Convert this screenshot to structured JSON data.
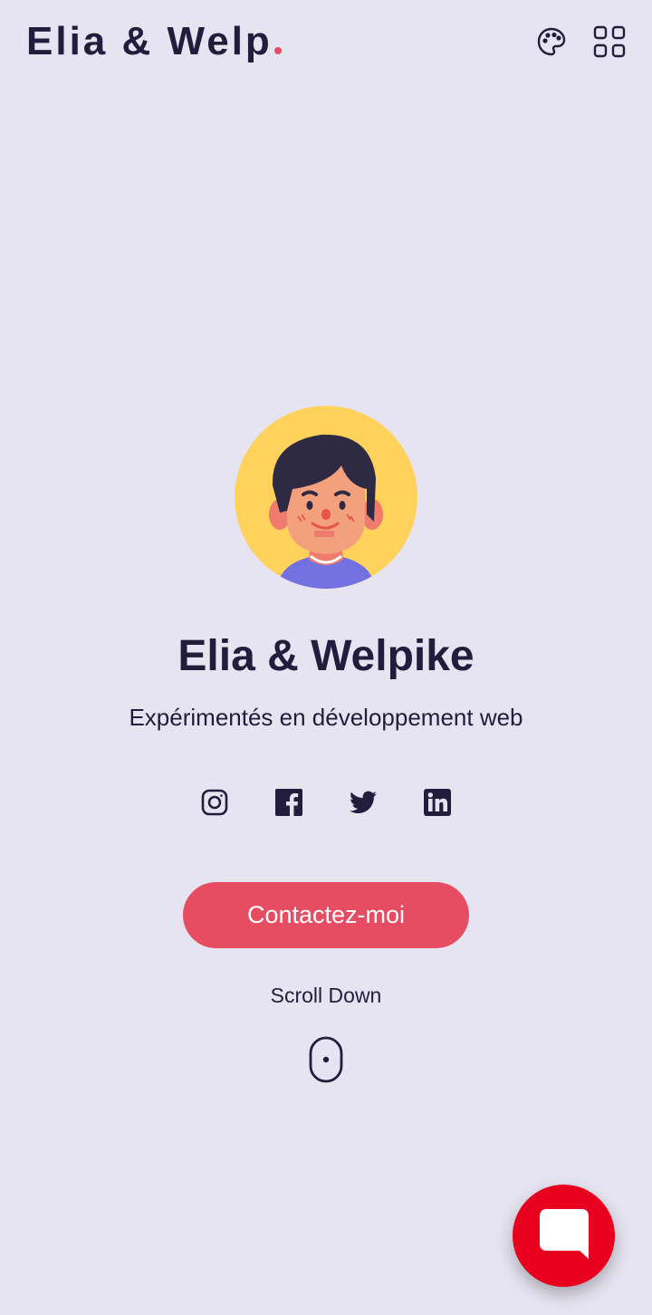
{
  "header": {
    "logo_text": "Elia & Welp",
    "theme_icon": "palette-icon",
    "menu_icon": "apps-grid-icon"
  },
  "hero": {
    "avatar_icon": "avatar-illustration",
    "name": "Elia & Welpike",
    "subtitle": "Expérimentés en développement web",
    "socials": [
      {
        "icon": "instagram-icon"
      },
      {
        "icon": "facebook-icon"
      },
      {
        "icon": "twitter-icon"
      },
      {
        "icon": "linkedin-icon"
      }
    ],
    "cta_label": "Contactez-moi",
    "scroll_label": "Scroll Down",
    "scroll_icon": "mouse-icon"
  },
  "chat": {
    "icon": "chat-bubble-icon"
  },
  "colors": {
    "background": "#e6e4f0",
    "text": "#221d3d",
    "accent": "#e64c62",
    "chat": "#e8001f",
    "avatar_bg": "#ffd25c"
  }
}
